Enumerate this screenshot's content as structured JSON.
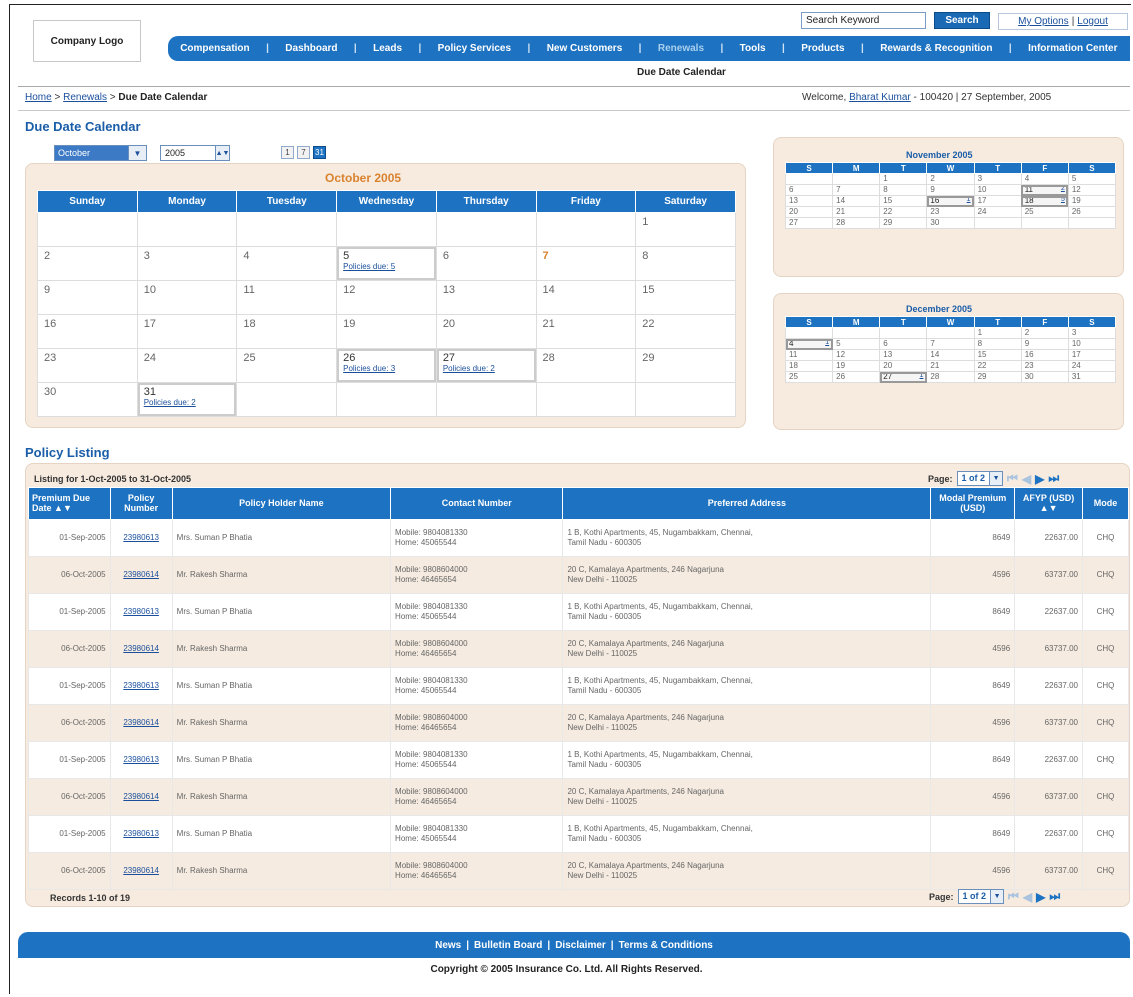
{
  "header": {
    "logo": "Company Logo",
    "search_value": "Search Keyword",
    "search_button": "Search",
    "my_options": "My Options",
    "logout": "Logout"
  },
  "nav": {
    "items": [
      "Compensation",
      "Dashboard",
      "Leads",
      "Policy Services",
      "New Customers",
      "Renewals",
      "Tools",
      "Products",
      "Rewards & Recognition",
      "Information Center"
    ],
    "active": "Renewals",
    "sub": "Due Date Calendar"
  },
  "breadcrumb": {
    "home": "Home",
    "renewals": "Renewals",
    "current": "Due Date Calendar"
  },
  "welcome": {
    "prefix": "Welcome, ",
    "user": "Bharat Kumar",
    "suffix": " - 100420  |  27 September, 2005"
  },
  "calendar": {
    "title": "Due Date Calendar",
    "month_select": "October",
    "year": "2005",
    "views": [
      "1",
      "7",
      "31"
    ],
    "month_title": "October 2005",
    "days": [
      "Sunday",
      "Monday",
      "Tuesday",
      "Wednesday",
      "Thursday",
      "Friday",
      "Saturday"
    ],
    "weeks": [
      [
        {
          "d": ""
        },
        {
          "d": ""
        },
        {
          "d": ""
        },
        {
          "d": ""
        },
        {
          "d": ""
        },
        {
          "d": ""
        },
        {
          "d": "1"
        }
      ],
      [
        {
          "d": "2"
        },
        {
          "d": "3"
        },
        {
          "d": "4"
        },
        {
          "d": "5",
          "due": "Policies due: 5"
        },
        {
          "d": "6"
        },
        {
          "d": "7",
          "focus": true
        },
        {
          "d": "8"
        }
      ],
      [
        {
          "d": "9"
        },
        {
          "d": "10"
        },
        {
          "d": "11"
        },
        {
          "d": "12"
        },
        {
          "d": "13"
        },
        {
          "d": "14"
        },
        {
          "d": "15"
        }
      ],
      [
        {
          "d": "16"
        },
        {
          "d": "17"
        },
        {
          "d": "18"
        },
        {
          "d": "19"
        },
        {
          "d": "20"
        },
        {
          "d": "21"
        },
        {
          "d": "22"
        }
      ],
      [
        {
          "d": "23"
        },
        {
          "d": "24"
        },
        {
          "d": "25"
        },
        {
          "d": "26",
          "due": "Policies due: 3"
        },
        {
          "d": "27",
          "due": "Policies due: 2"
        },
        {
          "d": "28"
        },
        {
          "d": "29"
        }
      ],
      [
        {
          "d": "30"
        },
        {
          "d": "31",
          "due": "Policies due: 2"
        },
        {
          "d": ""
        },
        {
          "d": ""
        },
        {
          "d": ""
        },
        {
          "d": ""
        },
        {
          "d": ""
        }
      ]
    ]
  },
  "mini_calendars": [
    {
      "title": "November 2005",
      "heads": [
        "S",
        "M",
        "T",
        "W",
        "T",
        "F",
        "S"
      ],
      "weeks": [
        [
          "",
          "",
          "1",
          "2",
          "3",
          "4",
          "5"
        ],
        [
          "6",
          "7",
          "8",
          "9",
          "10",
          "11|2",
          "12"
        ],
        [
          "13",
          "14",
          "15",
          "16|1",
          "17",
          "18|5",
          "19"
        ],
        [
          "20",
          "21",
          "22",
          "23",
          "24",
          "25",
          "26"
        ],
        [
          "27",
          "28",
          "29",
          "30",
          "",
          "",
          ""
        ]
      ]
    },
    {
      "title": "December 2005",
      "heads": [
        "S",
        "M",
        "T",
        "W",
        "T",
        "F",
        "S"
      ],
      "weeks": [
        [
          "",
          "",
          "",
          "",
          "1",
          "2",
          "3"
        ],
        [
          "4|1",
          "5",
          "6",
          "7",
          "8",
          "9",
          "10"
        ],
        [
          "11",
          "12",
          "13",
          "14",
          "15",
          "16",
          "17"
        ],
        [
          "18",
          "19",
          "20",
          "21",
          "22",
          "23",
          "24"
        ],
        [
          "25",
          "26",
          "27|1",
          "28",
          "29",
          "30",
          "31"
        ]
      ]
    }
  ],
  "policy": {
    "title": "Policy Listing",
    "listing_for": "Listing for 1-Oct-2005 to 31-Oct-2005",
    "page_label": "Page:",
    "page_value": "1 of 2",
    "records": "Records 1-10 of 19",
    "columns": [
      "Premium Due Date",
      "Policy Number",
      "Policy Holder Name",
      "Contact Number",
      "Preferred Address",
      "Modal Premium (USD)",
      "AFYP (USD)",
      "Mode"
    ],
    "rows": [
      [
        "01-Sep-2005",
        "23980613",
        "Mrs. Suman P Bhatia",
        "Mobile: 9804081330",
        "Home: 45065544",
        "1 B, Kothi Apartments, 45, Nugambakkam, Chennai,",
        "Tamil Nadu - 600305",
        "8649",
        "22637.00",
        "CHQ"
      ],
      [
        "06-Oct-2005",
        "23980614",
        "Mr. Rakesh Sharma",
        "Mobile: 9808604000",
        "Home: 46465654",
        "20 C, Kamalaya Apartments, 246 Nagarjuna",
        "New Delhi - 110025",
        "4596",
        "63737.00",
        "CHQ"
      ],
      [
        "01-Sep-2005",
        "23980613",
        "Mrs. Suman P Bhatia",
        "Mobile: 9804081330",
        "Home: 45065544",
        "1 B, Kothi Apartments, 45, Nugambakkam, Chennai,",
        "Tamil Nadu - 600305",
        "8649",
        "22637.00",
        "CHQ"
      ],
      [
        "06-Oct-2005",
        "23980614",
        "Mr. Rakesh Sharma",
        "Mobile: 9808604000",
        "Home: 46465654",
        "20 C, Kamalaya Apartments, 246 Nagarjuna",
        "New Delhi - 110025",
        "4596",
        "63737.00",
        "CHQ"
      ],
      [
        "01-Sep-2005",
        "23980613",
        "Mrs. Suman P Bhatia",
        "Mobile: 9804081330",
        "Home: 45065544",
        "1 B, Kothi Apartments, 45, Nugambakkam, Chennai,",
        "Tamil Nadu - 600305",
        "8649",
        "22637.00",
        "CHQ"
      ],
      [
        "06-Oct-2005",
        "23980614",
        "Mr. Rakesh Sharma",
        "Mobile: 9808604000",
        "Home: 46465654",
        "20 C, Kamalaya Apartments, 246 Nagarjuna",
        "New Delhi - 110025",
        "4596",
        "63737.00",
        "CHQ"
      ],
      [
        "01-Sep-2005",
        "23980613",
        "Mrs. Suman P Bhatia",
        "Mobile: 9804081330",
        "Home: 45065544",
        "1 B, Kothi Apartments, 45, Nugambakkam, Chennai,",
        "Tamil Nadu - 600305",
        "8649",
        "22637.00",
        "CHQ"
      ],
      [
        "06-Oct-2005",
        "23980614",
        "Mr. Rakesh Sharma",
        "Mobile: 9808604000",
        "Home: 46465654",
        "20 C, Kamalaya Apartments, 246 Nagarjuna",
        "New Delhi - 110025",
        "4596",
        "63737.00",
        "CHQ"
      ],
      [
        "01-Sep-2005",
        "23980613",
        "Mrs. Suman P Bhatia",
        "Mobile: 9804081330",
        "Home: 45065544",
        "1 B, Kothi Apartments, 45, Nugambakkam, Chennai,",
        "Tamil Nadu - 600305",
        "8649",
        "22637.00",
        "CHQ"
      ],
      [
        "06-Oct-2005",
        "23980614",
        "Mr. Rakesh Sharma",
        "Mobile: 9808604000",
        "Home: 46465654",
        "20 C, Kamalaya Apartments, 246 Nagarjuna",
        "New Delhi - 110025",
        "4596",
        "63737.00",
        "CHQ"
      ]
    ]
  },
  "footer": {
    "links": [
      "News",
      "Bulletin Board",
      "Disclaimer",
      "Terms & Conditions"
    ],
    "copyright": "Copyright © 2005 Insurance Co. Ltd. All Rights Reserved."
  },
  "colors": {
    "accent": "#1d72c1",
    "panel": "#f7ebe0",
    "highlight": "#d9832e"
  },
  "icons": [
    "dropdown-arrow-icon",
    "spin-arrow-icon",
    "first-page-icon",
    "prev-page-icon",
    "next-page-icon",
    "last-page-icon",
    "sort-arrow-icon"
  ]
}
